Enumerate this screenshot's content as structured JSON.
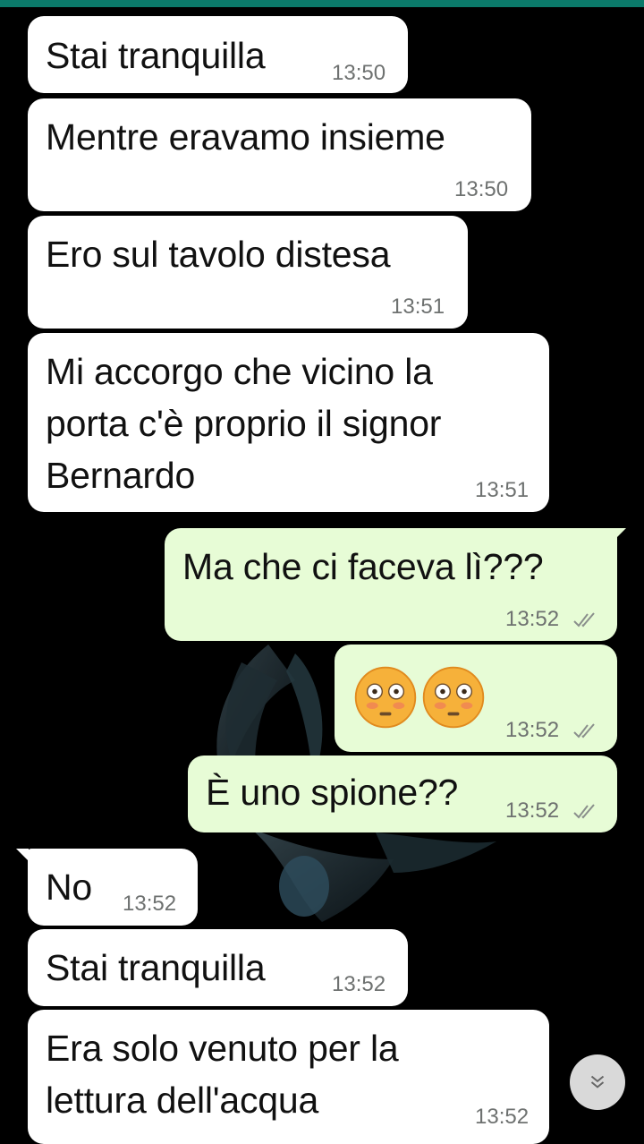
{
  "messages": [
    {
      "dir": "in",
      "text": "Stai tranquilla",
      "time": "13:50"
    },
    {
      "dir": "in",
      "text": "Mentre eravamo insieme",
      "time": "13:50"
    },
    {
      "dir": "in",
      "text": "Ero sul tavolo distesa",
      "time": "13:51"
    },
    {
      "dir": "in",
      "text": "Mi accorgo che vicino la\nporta c'è proprio il signor\nBernardo",
      "time": "13:51"
    },
    {
      "dir": "out",
      "text": "Ma che ci faceva lì???",
      "time": "13:52",
      "status": "read-double-tick"
    },
    {
      "dir": "out",
      "text": "😳😳",
      "emoji": "flushed-face-x2",
      "time": "13:52",
      "status": "read-double-tick"
    },
    {
      "dir": "out",
      "text": "È uno spione??",
      "time": "13:52",
      "status": "read-double-tick"
    },
    {
      "dir": "in",
      "text": "No",
      "time": "13:52"
    },
    {
      "dir": "in",
      "text": "Stai tranquilla",
      "time": "13:52"
    },
    {
      "dir": "in",
      "text": "Era solo venuto per la\nlettura dell'acqua",
      "time": "13:52"
    }
  ],
  "colors": {
    "background": "#000000",
    "incoming_bubble": "#ffffff",
    "outgoing_bubble": "#e7fcd6",
    "timestamp": "#6e7170",
    "tick": "#8a8f8c",
    "top_bar": "#0b7a6a"
  },
  "icons": {
    "scroll_down": "double-chevron-down-icon",
    "wallpaper": "betta-fish-wallpaper"
  }
}
